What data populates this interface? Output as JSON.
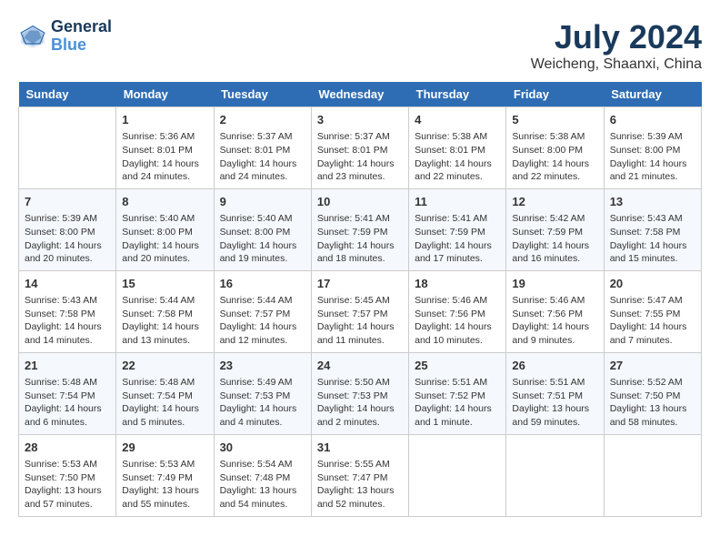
{
  "header": {
    "logo_line1": "General",
    "logo_line2": "Blue",
    "month": "July 2024",
    "location": "Weicheng, Shaanxi, China"
  },
  "weekdays": [
    "Sunday",
    "Monday",
    "Tuesday",
    "Wednesday",
    "Thursday",
    "Friday",
    "Saturday"
  ],
  "weeks": [
    [
      {
        "day": "",
        "info": ""
      },
      {
        "day": "1",
        "info": "Sunrise: 5:36 AM\nSunset: 8:01 PM\nDaylight: 14 hours\nand 24 minutes."
      },
      {
        "day": "2",
        "info": "Sunrise: 5:37 AM\nSunset: 8:01 PM\nDaylight: 14 hours\nand 24 minutes."
      },
      {
        "day": "3",
        "info": "Sunrise: 5:37 AM\nSunset: 8:01 PM\nDaylight: 14 hours\nand 23 minutes."
      },
      {
        "day": "4",
        "info": "Sunrise: 5:38 AM\nSunset: 8:01 PM\nDaylight: 14 hours\nand 22 minutes."
      },
      {
        "day": "5",
        "info": "Sunrise: 5:38 AM\nSunset: 8:00 PM\nDaylight: 14 hours\nand 22 minutes."
      },
      {
        "day": "6",
        "info": "Sunrise: 5:39 AM\nSunset: 8:00 PM\nDaylight: 14 hours\nand 21 minutes."
      }
    ],
    [
      {
        "day": "7",
        "info": "Sunrise: 5:39 AM\nSunset: 8:00 PM\nDaylight: 14 hours\nand 20 minutes."
      },
      {
        "day": "8",
        "info": "Sunrise: 5:40 AM\nSunset: 8:00 PM\nDaylight: 14 hours\nand 20 minutes."
      },
      {
        "day": "9",
        "info": "Sunrise: 5:40 AM\nSunset: 8:00 PM\nDaylight: 14 hours\nand 19 minutes."
      },
      {
        "day": "10",
        "info": "Sunrise: 5:41 AM\nSunset: 7:59 PM\nDaylight: 14 hours\nand 18 minutes."
      },
      {
        "day": "11",
        "info": "Sunrise: 5:41 AM\nSunset: 7:59 PM\nDaylight: 14 hours\nand 17 minutes."
      },
      {
        "day": "12",
        "info": "Sunrise: 5:42 AM\nSunset: 7:59 PM\nDaylight: 14 hours\nand 16 minutes."
      },
      {
        "day": "13",
        "info": "Sunrise: 5:43 AM\nSunset: 7:58 PM\nDaylight: 14 hours\nand 15 minutes."
      }
    ],
    [
      {
        "day": "14",
        "info": "Sunrise: 5:43 AM\nSunset: 7:58 PM\nDaylight: 14 hours\nand 14 minutes."
      },
      {
        "day": "15",
        "info": "Sunrise: 5:44 AM\nSunset: 7:58 PM\nDaylight: 14 hours\nand 13 minutes."
      },
      {
        "day": "16",
        "info": "Sunrise: 5:44 AM\nSunset: 7:57 PM\nDaylight: 14 hours\nand 12 minutes."
      },
      {
        "day": "17",
        "info": "Sunrise: 5:45 AM\nSunset: 7:57 PM\nDaylight: 14 hours\nand 11 minutes."
      },
      {
        "day": "18",
        "info": "Sunrise: 5:46 AM\nSunset: 7:56 PM\nDaylight: 14 hours\nand 10 minutes."
      },
      {
        "day": "19",
        "info": "Sunrise: 5:46 AM\nSunset: 7:56 PM\nDaylight: 14 hours\nand 9 minutes."
      },
      {
        "day": "20",
        "info": "Sunrise: 5:47 AM\nSunset: 7:55 PM\nDaylight: 14 hours\nand 7 minutes."
      }
    ],
    [
      {
        "day": "21",
        "info": "Sunrise: 5:48 AM\nSunset: 7:54 PM\nDaylight: 14 hours\nand 6 minutes."
      },
      {
        "day": "22",
        "info": "Sunrise: 5:48 AM\nSunset: 7:54 PM\nDaylight: 14 hours\nand 5 minutes."
      },
      {
        "day": "23",
        "info": "Sunrise: 5:49 AM\nSunset: 7:53 PM\nDaylight: 14 hours\nand 4 minutes."
      },
      {
        "day": "24",
        "info": "Sunrise: 5:50 AM\nSunset: 7:53 PM\nDaylight: 14 hours\nand 2 minutes."
      },
      {
        "day": "25",
        "info": "Sunrise: 5:51 AM\nSunset: 7:52 PM\nDaylight: 14 hours\nand 1 minute."
      },
      {
        "day": "26",
        "info": "Sunrise: 5:51 AM\nSunset: 7:51 PM\nDaylight: 13 hours\nand 59 minutes."
      },
      {
        "day": "27",
        "info": "Sunrise: 5:52 AM\nSunset: 7:50 PM\nDaylight: 13 hours\nand 58 minutes."
      }
    ],
    [
      {
        "day": "28",
        "info": "Sunrise: 5:53 AM\nSunset: 7:50 PM\nDaylight: 13 hours\nand 57 minutes."
      },
      {
        "day": "29",
        "info": "Sunrise: 5:53 AM\nSunset: 7:49 PM\nDaylight: 13 hours\nand 55 minutes."
      },
      {
        "day": "30",
        "info": "Sunrise: 5:54 AM\nSunset: 7:48 PM\nDaylight: 13 hours\nand 54 minutes."
      },
      {
        "day": "31",
        "info": "Sunrise: 5:55 AM\nSunset: 7:47 PM\nDaylight: 13 hours\nand 52 minutes."
      },
      {
        "day": "",
        "info": ""
      },
      {
        "day": "",
        "info": ""
      },
      {
        "day": "",
        "info": ""
      }
    ]
  ]
}
